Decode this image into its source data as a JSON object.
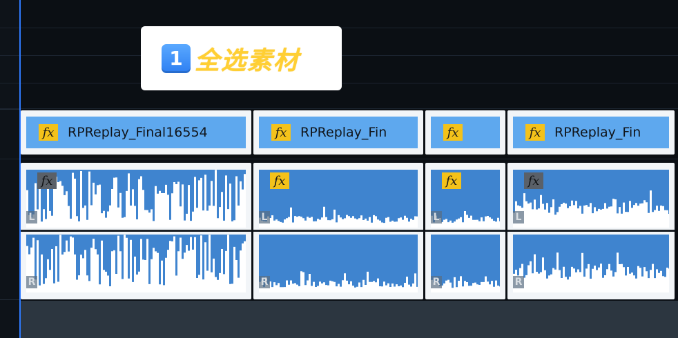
{
  "annotation": {
    "step": "1",
    "text": "全选素材"
  },
  "fx_label": "fx",
  "channel_labels": {
    "left": "L",
    "right": "R"
  },
  "clips": [
    {
      "name": "RPReplay_Final16554",
      "fx_video": "yellow",
      "fx_audio": "gray",
      "waveform": "loud"
    },
    {
      "name": "RPReplay_Fin",
      "fx_video": "yellow",
      "fx_audio": "yellow",
      "waveform": "quiet"
    },
    {
      "name": "",
      "fx_video": "yellow",
      "fx_audio": "yellow",
      "waveform": "quiet"
    },
    {
      "name": "RPReplay_Fin",
      "fx_video": "yellow",
      "fx_audio": "gray",
      "waveform": "medium"
    }
  ],
  "colors": {
    "clip_video": "#5ea8ee",
    "clip_audio": "#3f84cf",
    "fx_badge": "#f4c21a",
    "playhead": "#2f7bff",
    "annotation_text": "#ffcf33"
  }
}
